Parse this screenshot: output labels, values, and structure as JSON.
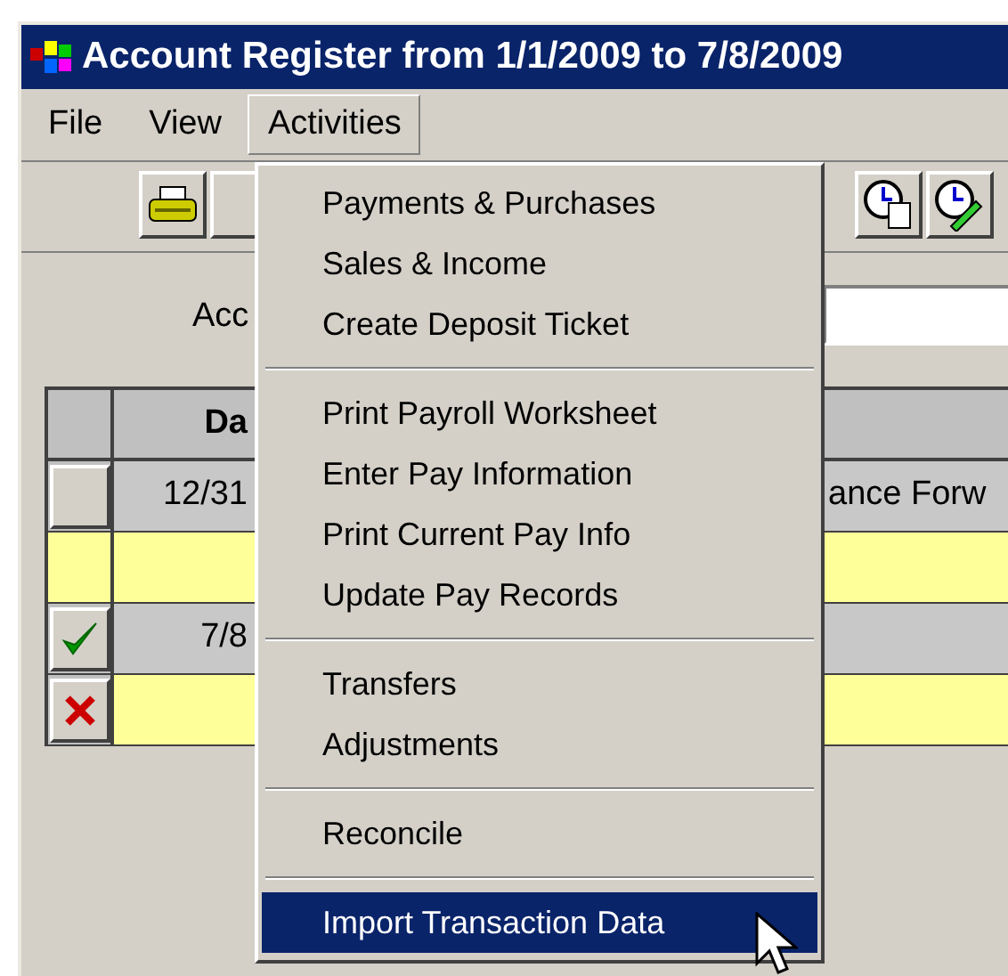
{
  "window": {
    "title": "Account Register from 1/1/2009 to 7/8/2009"
  },
  "menu_bar": [
    {
      "label": "File",
      "selected": false
    },
    {
      "label": "View",
      "selected": false
    },
    {
      "label": "Activities",
      "selected": true
    }
  ],
  "account_label": "Acc",
  "register": {
    "columns": [
      "Da"
    ],
    "rows": [
      {
        "kind": "blank",
        "highlighted": false,
        "date": "12/31",
        "description": "ance Forw"
      },
      {
        "kind": "none",
        "highlighted": true
      },
      {
        "kind": "check",
        "highlighted": false,
        "date": "7/8"
      },
      {
        "kind": "cross",
        "highlighted": true
      }
    ]
  },
  "menu": [
    {
      "kind": "item",
      "label": "Payments & Purchases",
      "selected": false
    },
    {
      "kind": "item",
      "label": "Sales & Income",
      "selected": false
    },
    {
      "kind": "item",
      "label": "Create Deposit Ticket",
      "selected": false
    },
    {
      "kind": "separator"
    },
    {
      "kind": "item",
      "label": "Print Payroll Worksheet",
      "selected": false
    },
    {
      "kind": "item",
      "label": "Enter Pay Information",
      "selected": false
    },
    {
      "kind": "item",
      "label": "Print Current Pay Info",
      "selected": false
    },
    {
      "kind": "item",
      "label": "Update Pay Records",
      "selected": false
    },
    {
      "kind": "separator"
    },
    {
      "kind": "item",
      "label": "Transfers",
      "selected": false
    },
    {
      "kind": "item",
      "label": "Adjustments",
      "selected": false
    },
    {
      "kind": "separator"
    },
    {
      "kind": "item",
      "label": "Reconcile",
      "selected": false
    },
    {
      "kind": "separator"
    },
    {
      "kind": "item",
      "label": "Import Transaction Data",
      "selected": true
    }
  ]
}
